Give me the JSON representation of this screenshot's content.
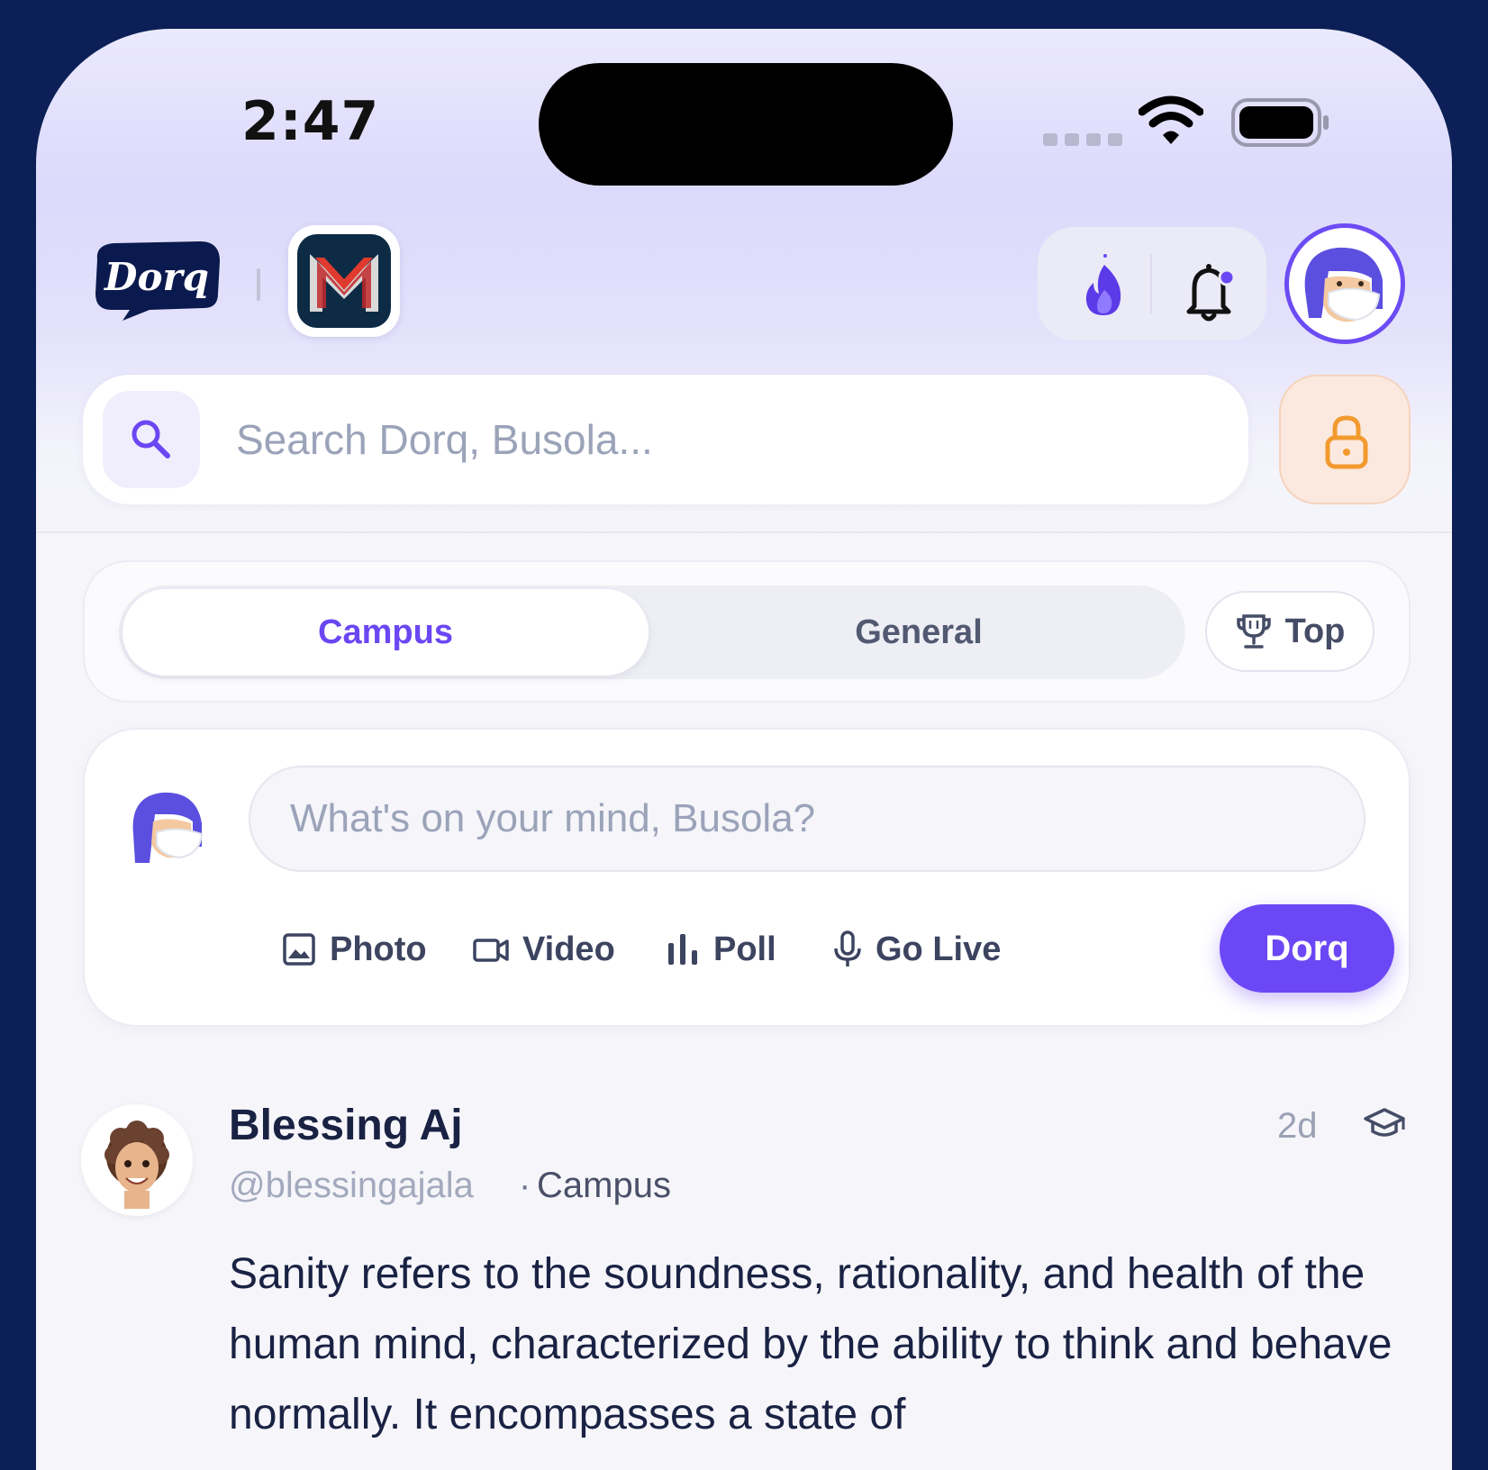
{
  "status_bar": {
    "time": "2:47"
  },
  "header": {
    "brand_name": "Dorq",
    "icons": {
      "streak": "fire-icon",
      "notifications": "bell-icon",
      "search": "search-icon",
      "lock": "lock-icon"
    }
  },
  "search": {
    "placeholder": "Search Dorq, Busola..."
  },
  "feed_tabs": {
    "campus": "Campus",
    "general": "General",
    "top": "Top"
  },
  "composer": {
    "placeholder": "What's on your mind, Busola?",
    "photo": "Photo",
    "video": "Video",
    "poll": "Poll",
    "go_live": "Go Live",
    "post_button": "Dorq"
  },
  "post": {
    "author_name": "Blessing Aj",
    "handle": "@blessingajala",
    "separator": "·",
    "scope": "Campus",
    "time_ago": "2d",
    "body": "Sanity refers to the soundness, rationality, and health of the human mind, characterized by the ability to think and behave normally. It encompasses a state of"
  },
  "colors": {
    "accent": "#6c47f5",
    "frame": "#0c2057",
    "text": "#1a2244",
    "lock_bg": "#fbe9df",
    "lock_icon": "#f29a2e"
  }
}
